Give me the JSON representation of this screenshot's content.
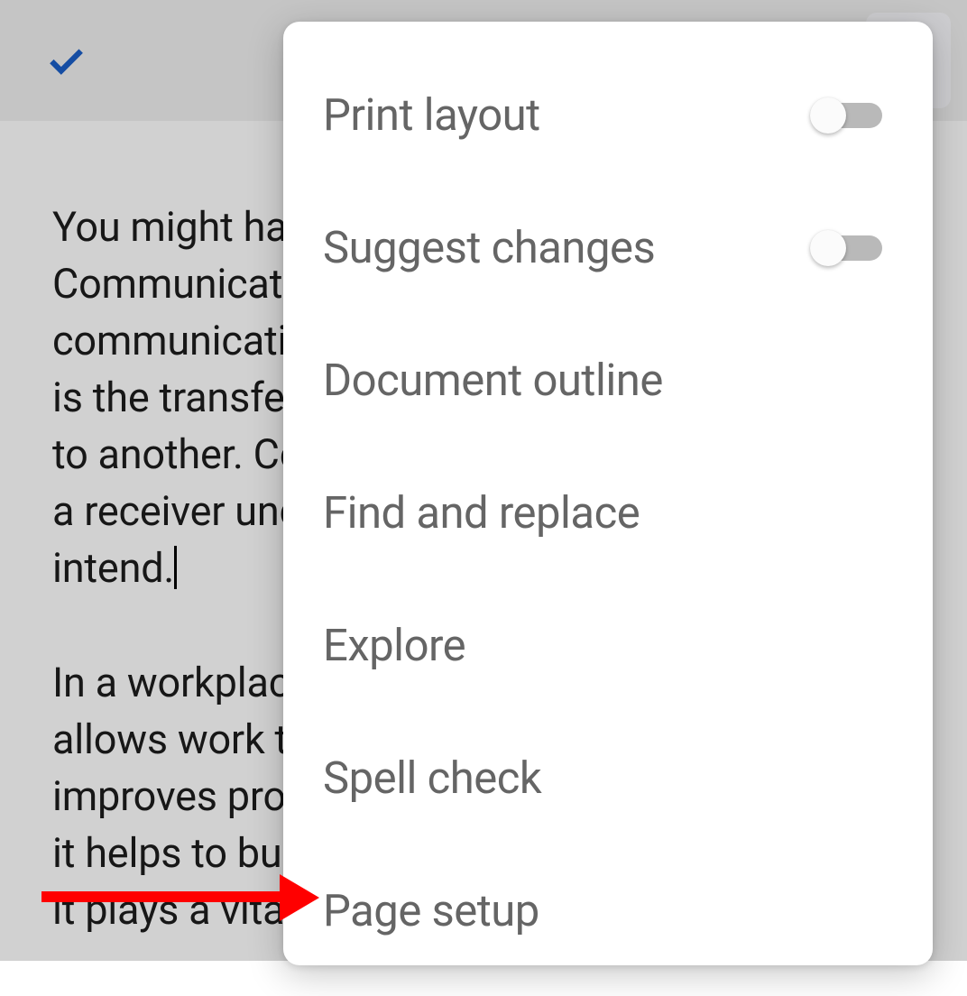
{
  "menu": {
    "items": [
      {
        "label": "Print layout",
        "has_toggle": true,
        "toggle_on": false
      },
      {
        "label": "Suggest changes",
        "has_toggle": true,
        "toggle_on": false
      },
      {
        "label": "Document outline",
        "has_toggle": false
      },
      {
        "label": "Find and replace",
        "has_toggle": false
      },
      {
        "label": "Explore",
        "has_toggle": false
      },
      {
        "label": "Spell check",
        "has_toggle": false
      },
      {
        "label": "Page setup",
        "has_toggle": false
      }
    ]
  },
  "document": {
    "paragraph_1": "You might have heard this line quite often - Communication is the key. What makes communication important? Communication is the transfer of information from one place to another. Communication is effective when a receiver understands a message as you intend.",
    "paragraph_2_lines": [
      "In a workplace, communication is vital as it",
      "allows work to be done properly,",
      "improves productivity,",
      "it helps to build trust,",
      "it plays a vital role"
    ]
  },
  "annotation": {
    "target": "Page setup",
    "color": "#ff0000"
  }
}
